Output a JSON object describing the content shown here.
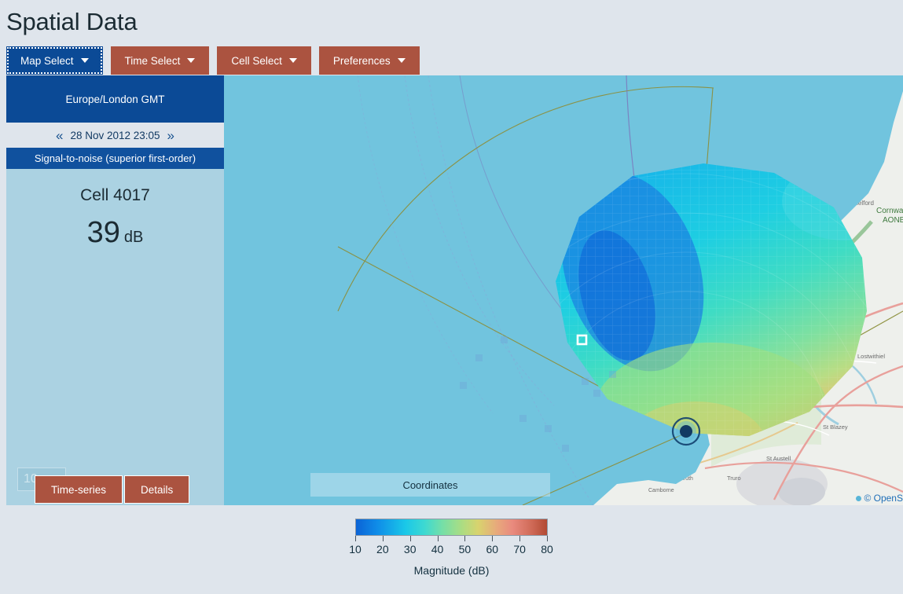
{
  "page": {
    "title": "Spatial Data",
    "background_color": "#dfe5ec"
  },
  "colors": {
    "accent_orange": "#ab5340",
    "accent_navy": "#0b4a96",
    "panel_blue": "#abd2e2",
    "sea_blue": "#71c4de"
  },
  "menubar": {
    "items": [
      {
        "label": "Map Select",
        "active": true
      },
      {
        "label": "Time Select",
        "active": false
      },
      {
        "label": "Cell Select",
        "active": false
      },
      {
        "label": "Preferences",
        "active": false
      }
    ]
  },
  "sidebar": {
    "timezone": "Europe/London  GMT",
    "date_prev_icon": "«",
    "date_next_icon": "»",
    "datetime": "28 Nov 2012 23:05",
    "parameter": "Signal-to-noise (superior first-order)",
    "cell_label": "Cell 4017",
    "value": "39",
    "unit": "dB",
    "hidden_value": "10",
    "buttons": [
      {
        "label": "Time-series"
      },
      {
        "label": "Details"
      }
    ]
  },
  "map": {
    "coordinates_label": "Coordinates",
    "attribution": "© OpenS",
    "selected_cell_marker": "white-square",
    "station_marker": "radar-station"
  },
  "chart_data": {
    "type": "heatmap",
    "title": "Magnitude (dB)",
    "colorbar": {
      "ticks": [
        10,
        20,
        30,
        40,
        50,
        60,
        70,
        80
      ],
      "range": [
        10,
        80
      ],
      "unit": "dB",
      "orientation": "horizontal",
      "colormap": [
        "#0b63d6",
        "#1ac8e8",
        "#74dfa8",
        "#d8d36e",
        "#e98a7e",
        "#b24a33"
      ]
    },
    "xlabel": "",
    "ylabel": "",
    "selected_value": 39,
    "selected_cell": "Cell 4017",
    "timestamp": "28 Nov 2012 23:05",
    "parameter": "Signal-to-noise (superior first-order)"
  }
}
